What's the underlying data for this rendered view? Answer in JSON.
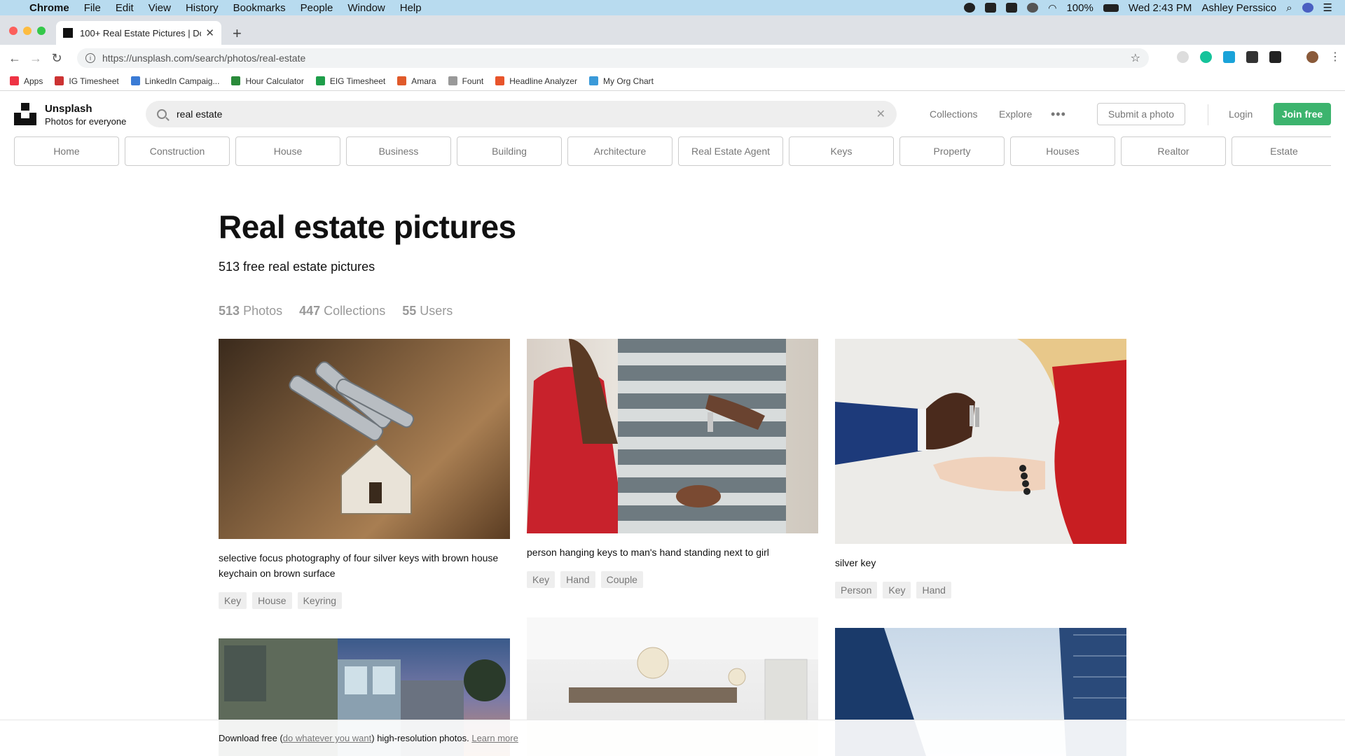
{
  "menubar": {
    "app": "Chrome",
    "items": [
      "File",
      "Edit",
      "View",
      "History",
      "Bookmarks",
      "People",
      "Window",
      "Help"
    ],
    "battery": "100%",
    "clock": "Wed 2:43 PM",
    "user": "Ashley Perssico"
  },
  "browser": {
    "tab_title": "100+ Real Estate Pictures | Do",
    "url": "https://unsplash.com/search/photos/real-estate",
    "bookmarks": [
      {
        "label": "Apps",
        "color": "#e34"
      },
      {
        "label": "IG Timesheet",
        "color": "#c33"
      },
      {
        "label": "LinkedIn Campaig...",
        "color": "#3a7bd5"
      },
      {
        "label": "Hour Calculator",
        "color": "#2a8a3a"
      },
      {
        "label": "EIG Timesheet",
        "color": "#1e9e4a"
      },
      {
        "label": "Amara",
        "color": "#e05a2a"
      },
      {
        "label": "Fount",
        "color": "#999"
      },
      {
        "label": "Headline Analyzer",
        "color": "#e8542b"
      },
      {
        "label": "My Org Chart",
        "color": "#3a9ad9"
      }
    ]
  },
  "header": {
    "brand": "Unsplash",
    "tagline": "Photos for everyone",
    "search_value": "real estate",
    "links": {
      "collections": "Collections",
      "explore": "Explore"
    },
    "submit": "Submit a photo",
    "login": "Login",
    "join": "Join free"
  },
  "chips": [
    "Home",
    "Construction",
    "House",
    "Business",
    "Building",
    "Architecture",
    "Real Estate Agent",
    "Keys",
    "Property",
    "Houses",
    "Realtor",
    "Estate"
  ],
  "main": {
    "title": "Real estate pictures",
    "subtitle": "513 free real estate pictures",
    "counts": [
      {
        "num": "513",
        "label": "Photos"
      },
      {
        "num": "447",
        "label": "Collections"
      },
      {
        "num": "55",
        "label": "Users"
      }
    ],
    "photos": [
      {
        "caption": "selective focus photography of four silver keys with brown house keychain on brown surface",
        "tags": [
          "Key",
          "House",
          "Keyring"
        ]
      },
      {
        "caption": "person hanging keys to man's hand standing next to girl",
        "tags": [
          "Key",
          "Hand",
          "Couple"
        ]
      },
      {
        "caption": "silver key",
        "tags": [
          "Person",
          "Key",
          "Hand"
        ]
      }
    ]
  },
  "banner": {
    "prefix": "Download free (",
    "link1": "do whatever you want",
    "middle": ") high-resolution photos. ",
    "link2": "Learn more"
  }
}
